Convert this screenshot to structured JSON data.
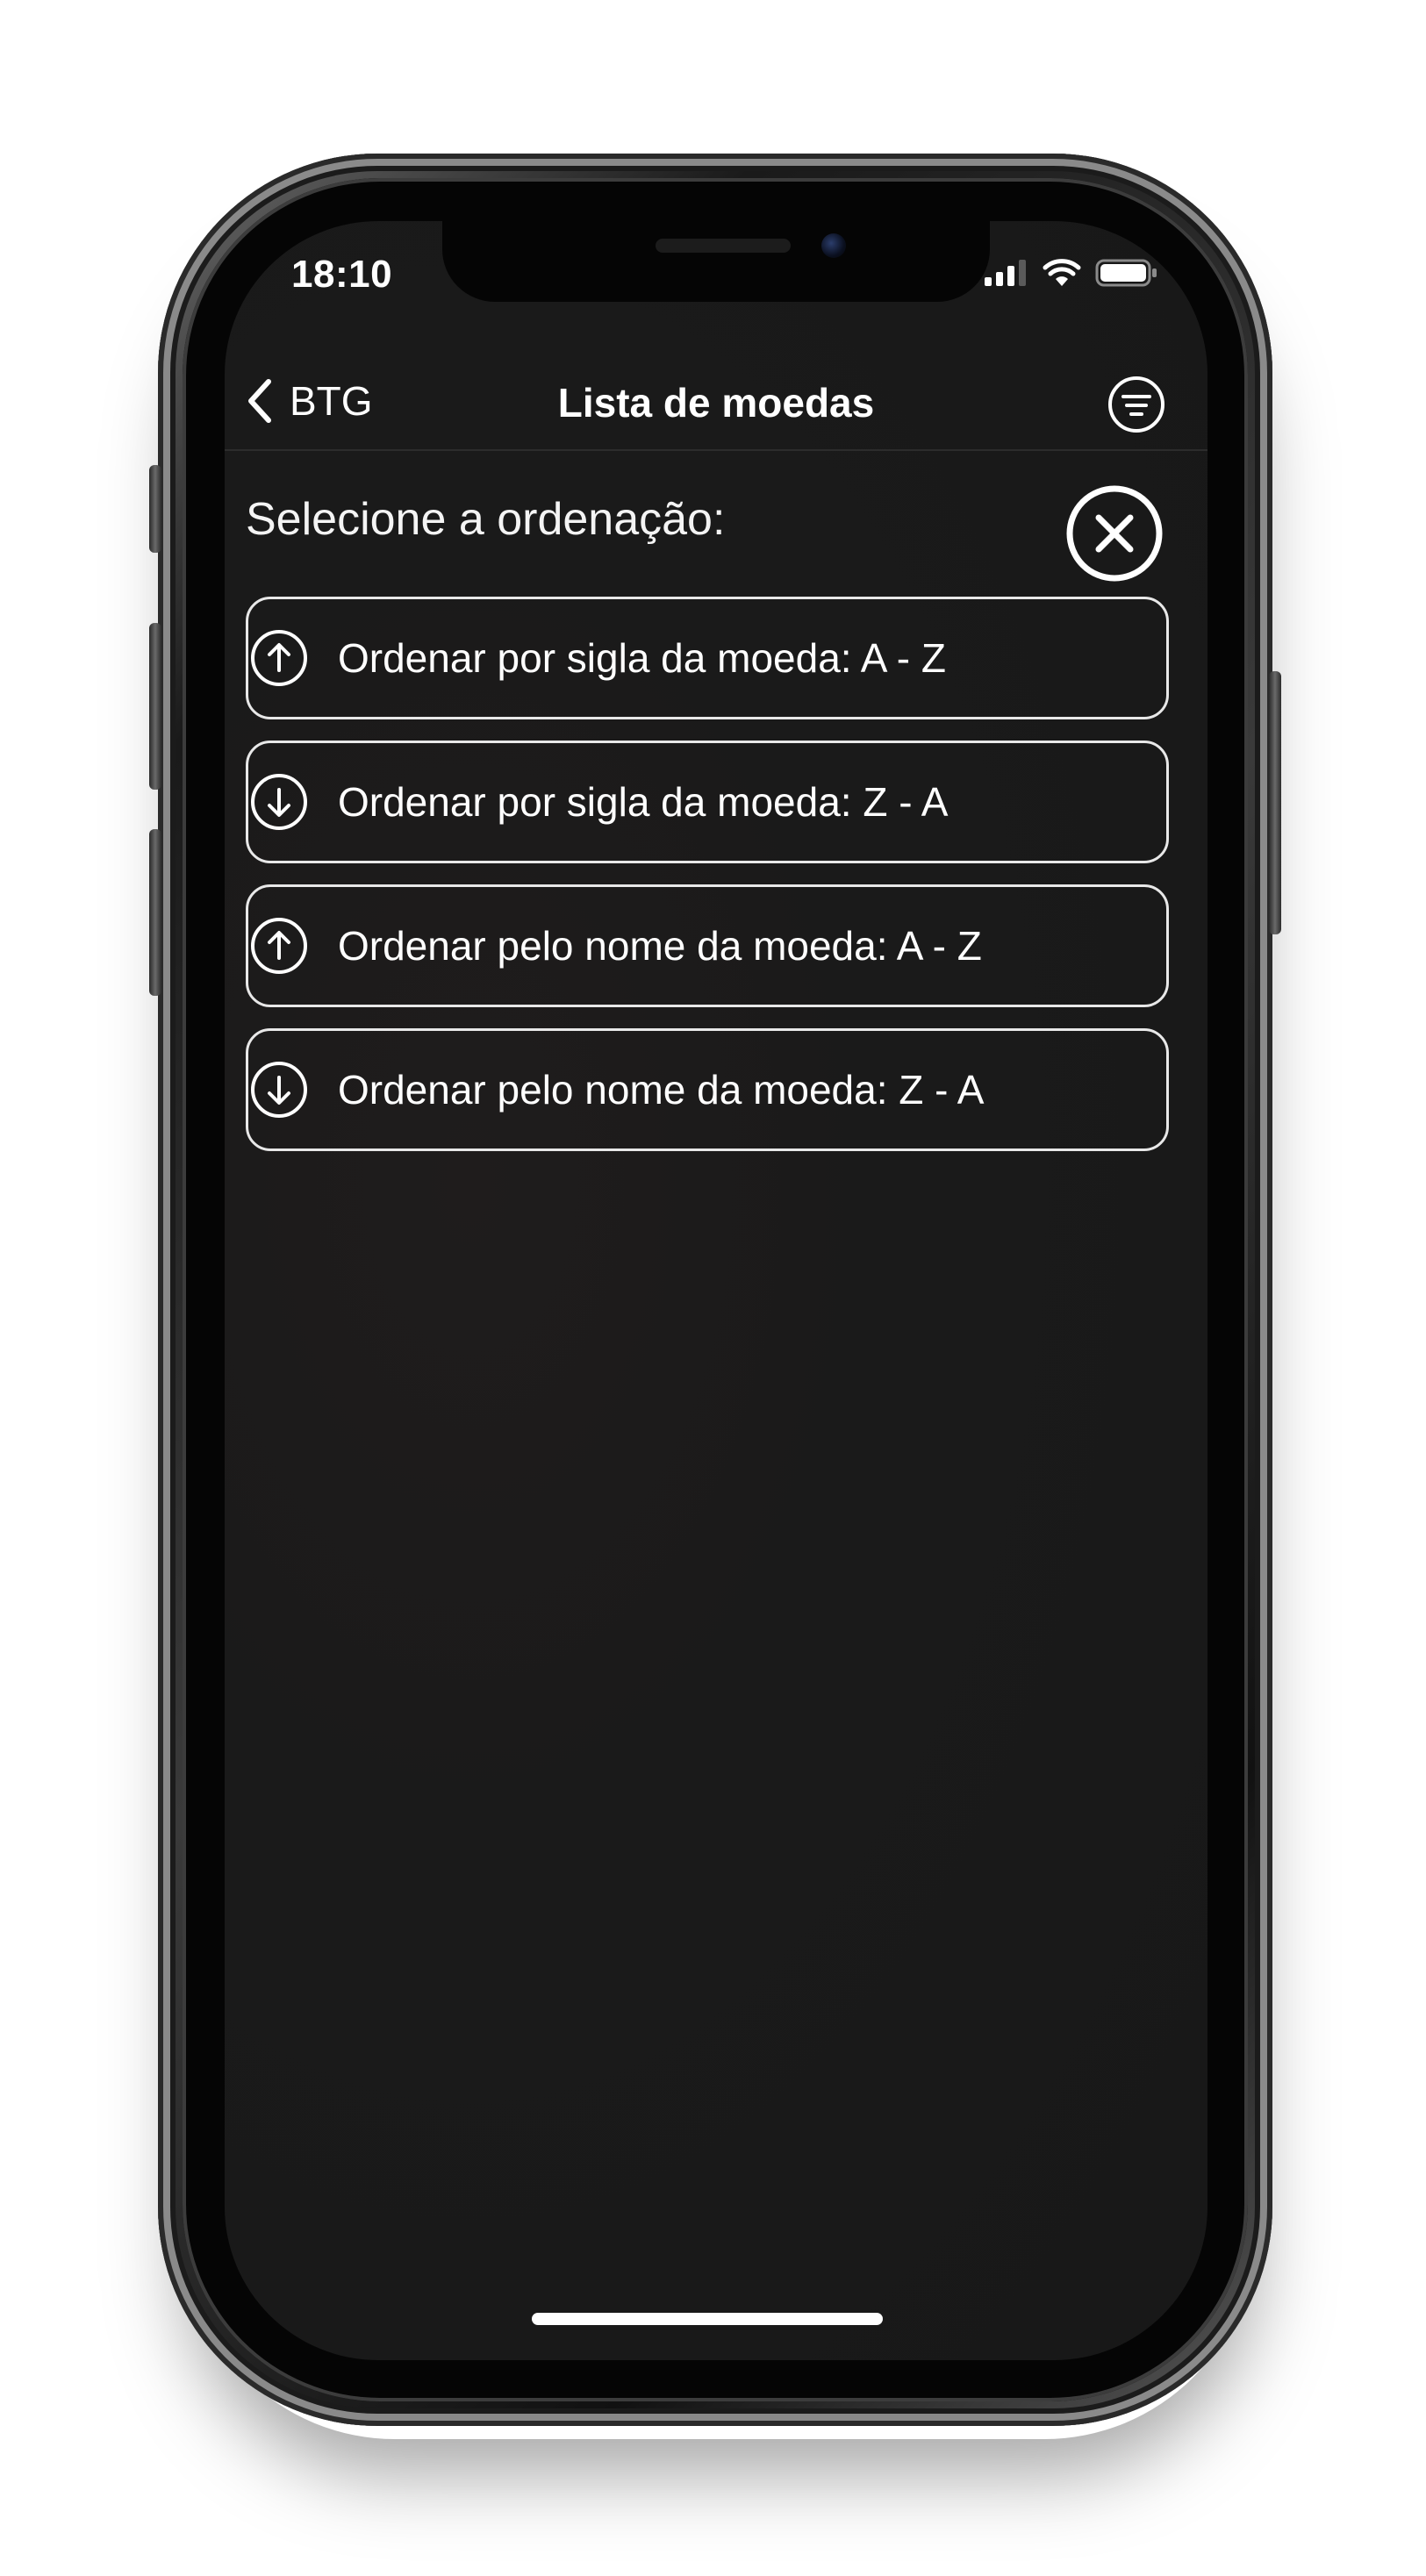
{
  "status_bar": {
    "time": "18:10",
    "icons": [
      "cellular-signal-icon",
      "wifi-icon",
      "battery-icon"
    ]
  },
  "navbar": {
    "back_label": "BTG",
    "title": "Lista de moedas",
    "back_icon": "chevron-left-icon",
    "right_icon": "filter-icon"
  },
  "sort_panel": {
    "title": "Selecione a ordenação:",
    "close_icon": "close-circle-icon",
    "options": [
      {
        "label": "Ordenar por sigla da moeda: A - Z",
        "icon": "arrow-up-circle-icon"
      },
      {
        "label": "Ordenar por sigla da moeda: Z - A",
        "icon": "arrow-down-circle-icon"
      },
      {
        "label": "Ordenar pelo nome da moeda: A - Z",
        "icon": "arrow-up-circle-icon"
      },
      {
        "label": "Ordenar pelo nome da moeda: Z - A",
        "icon": "arrow-down-circle-icon"
      }
    ]
  },
  "colors": {
    "background": "#1a1a1a",
    "text": "#ffffff",
    "outline": "#e8e8e8"
  }
}
